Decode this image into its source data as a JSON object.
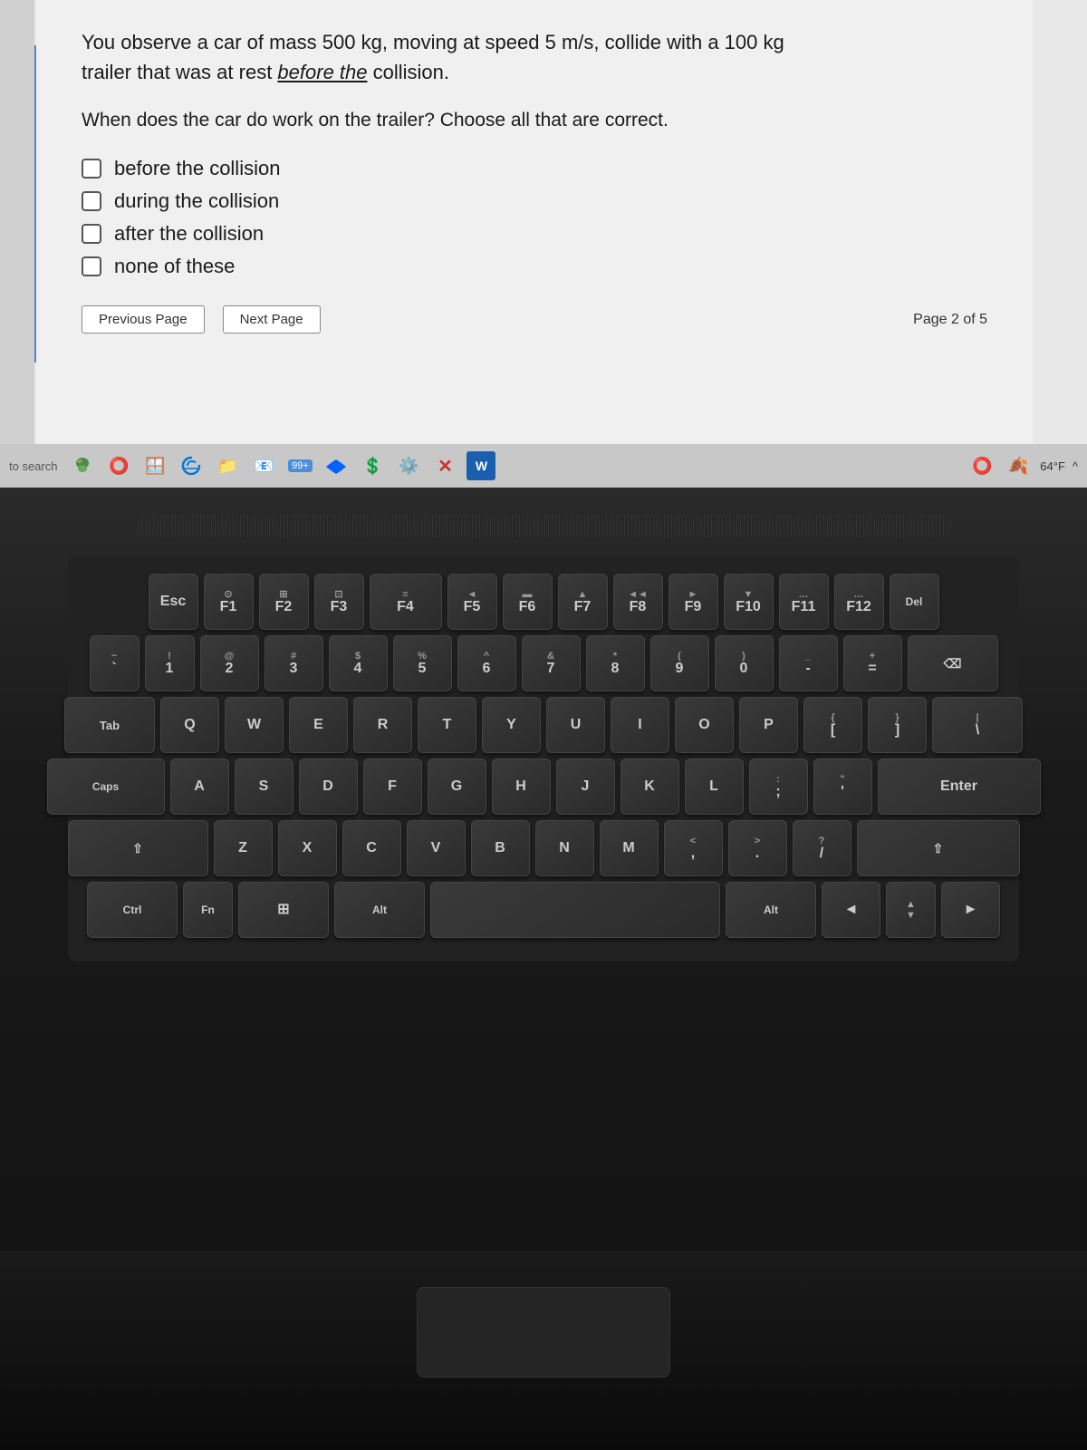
{
  "question": {
    "text_line1": "You observe a car of mass 500 kg, moving at speed 5 m/s, collide with a 100 kg",
    "text_line2": "trailer that was at rest before the collision.",
    "sub_question": "When does the car do work on the trailer? Choose all that are correct.",
    "choices": [
      {
        "id": "before",
        "label": "before the collision"
      },
      {
        "id": "during",
        "label": "during the collision"
      },
      {
        "id": "after",
        "label": "after the collision"
      },
      {
        "id": "none",
        "label": "none of these"
      }
    ]
  },
  "navigation": {
    "prev_label": "Previous Page",
    "next_label": "Next Page",
    "page_indicator": "Page 2 of 5"
  },
  "taskbar": {
    "search_text": "to search",
    "badge_count": "99+",
    "temperature": "64°F"
  },
  "keyboard": {
    "rows": [
      [
        "2",
        "3",
        "4",
        "5",
        "6",
        "7",
        "8",
        "9",
        "O"
      ],
      [
        "W",
        "E",
        "R",
        "T",
        "Y",
        "U",
        "I",
        "O",
        "P"
      ],
      [
        "",
        "D",
        "F",
        "G",
        "H",
        "J",
        "K",
        "L",
        ""
      ],
      [
        "",
        "C",
        "V",
        "B",
        "N",
        "",
        "",
        "",
        ""
      ]
    ]
  }
}
